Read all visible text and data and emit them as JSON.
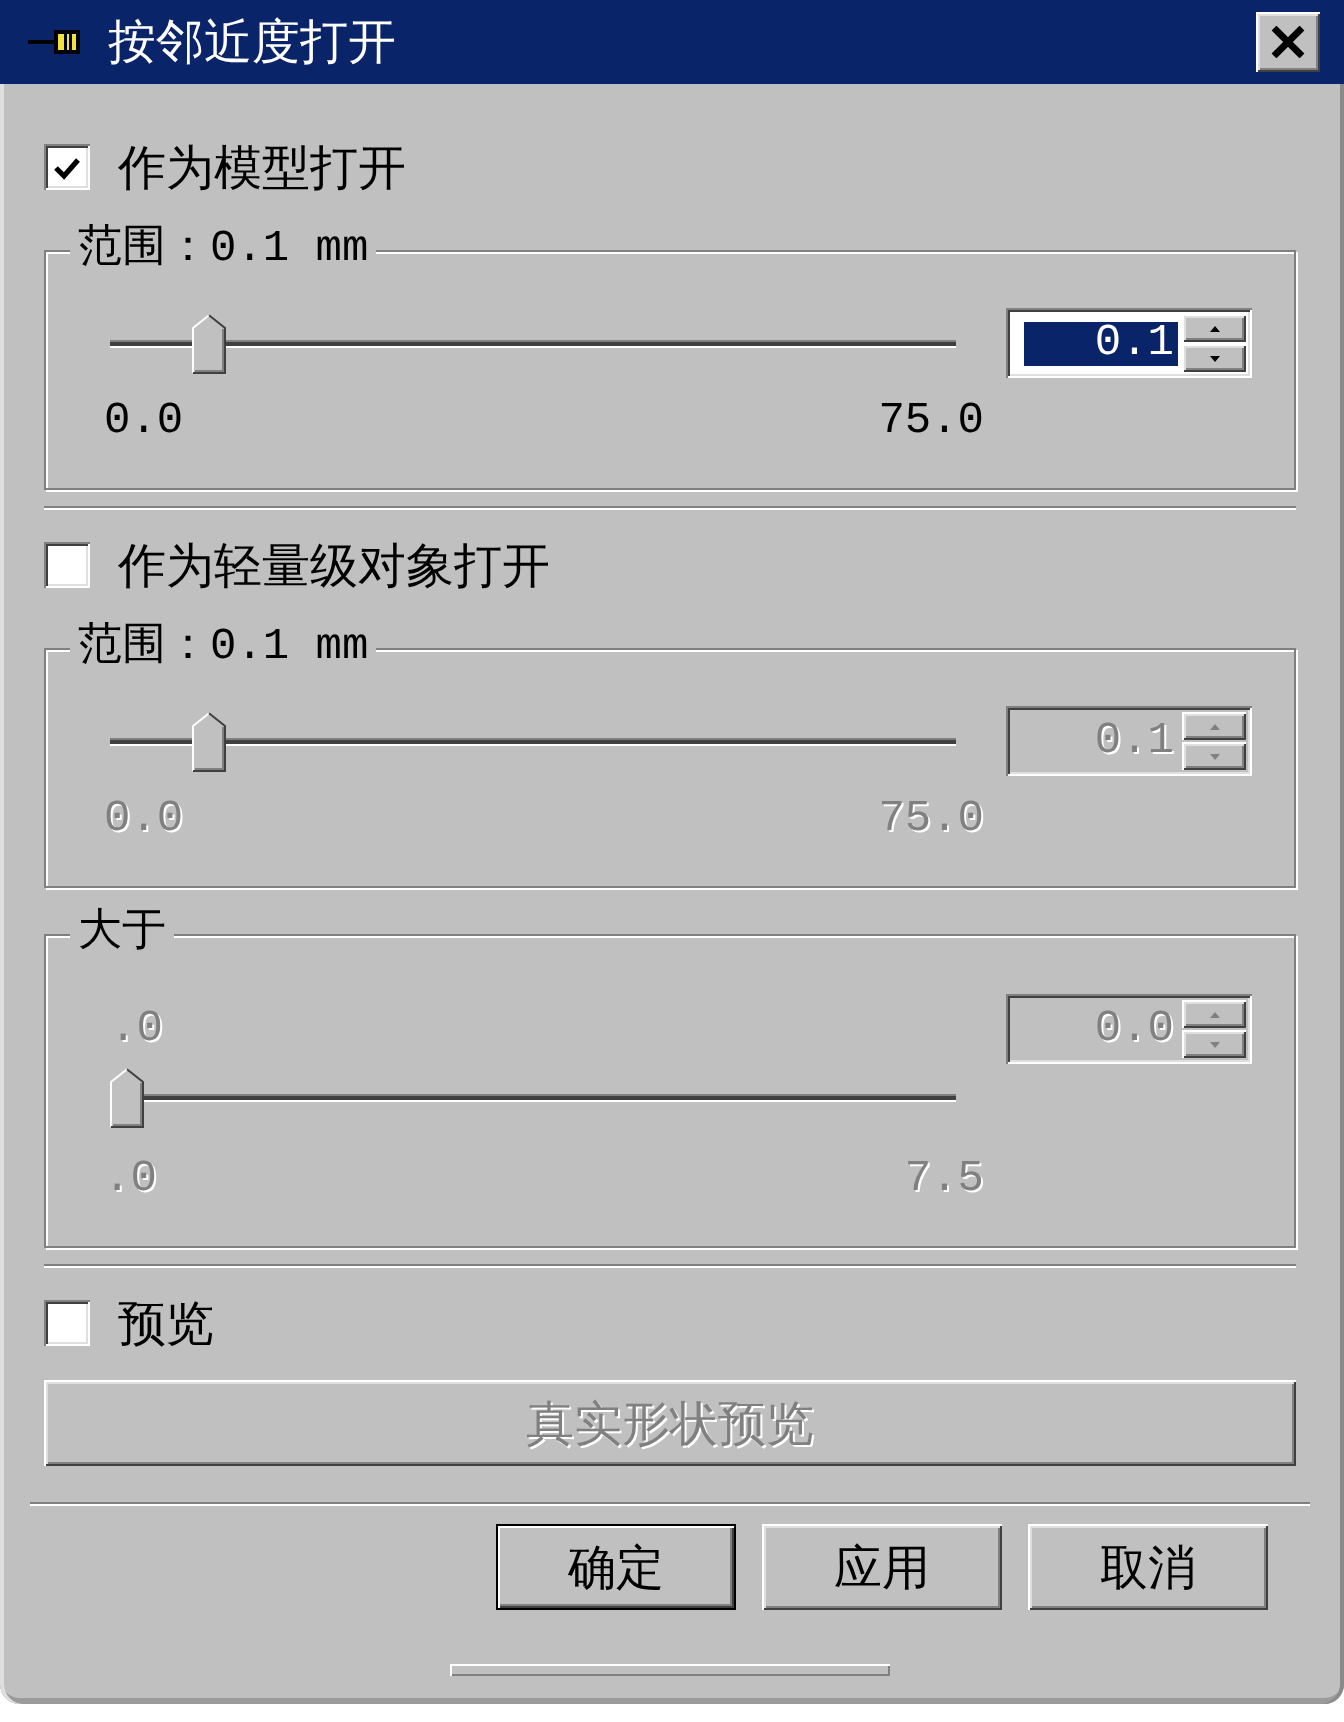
{
  "window": {
    "title": "按邻近度打开"
  },
  "sections": [
    {
      "checkbox": {
        "label": "作为模型打开",
        "checked": true
      },
      "groups": [
        {
          "kind": "range",
          "legend": "范围：0.1 mm",
          "disabled": false,
          "slider": {
            "level": 0.1
          },
          "spin": {
            "value": "0.1",
            "highlighted": true
          },
          "min_label": "0.0",
          "max_label": "75.0"
        }
      ]
    },
    {
      "checkbox": {
        "label": "作为轻量级对象打开",
        "checked": false
      },
      "groups": [
        {
          "kind": "range",
          "legend": "范围：0.1 mm",
          "disabled": true,
          "slider": {
            "level": 0.1
          },
          "spin": {
            "value": "0.1",
            "highlighted": false
          },
          "min_label": "0.0",
          "max_label": "75.0"
        },
        {
          "kind": "threshold",
          "legend": "大于",
          "disabled": true,
          "current_label": ".0",
          "slider": {
            "level": 0
          },
          "spin": {
            "value": "0.0",
            "highlighted": false
          },
          "min_label": ".0",
          "max_label": "7.5"
        }
      ]
    }
  ],
  "preview": {
    "checkbox": {
      "label": "预览",
      "checked": false
    },
    "button": {
      "label": "真实形状预览",
      "disabled": true
    }
  },
  "buttons": [
    {
      "label": "确定",
      "default": true
    },
    {
      "label": "应用",
      "default": false
    },
    {
      "label": "取消",
      "default": false
    }
  ]
}
